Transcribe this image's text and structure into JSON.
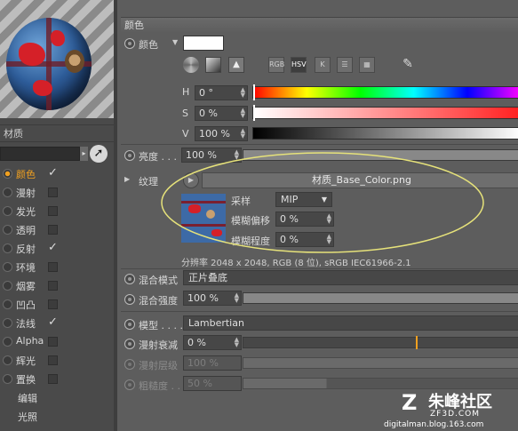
{
  "left": {
    "material_title": "材质",
    "channels": [
      {
        "label": "颜色",
        "checked": true,
        "active": true
      },
      {
        "label": "漫射",
        "checked": false
      },
      {
        "label": "发光",
        "checked": false
      },
      {
        "label": "透明",
        "checked": false
      },
      {
        "label": "反射",
        "checked": true
      },
      {
        "label": "环境",
        "checked": false
      },
      {
        "label": "烟雾",
        "checked": false
      },
      {
        "label": "凹凸",
        "checked": false
      },
      {
        "label": "法线",
        "checked": true
      },
      {
        "label": "Alpha",
        "checked": false
      },
      {
        "label": "辉光",
        "checked": false
      },
      {
        "label": "置换",
        "checked": false
      }
    ],
    "extra_items": [
      "编辑",
      "光照"
    ],
    "check_mark": "✓"
  },
  "color_section": {
    "header": "颜色",
    "color_label": "颜色",
    "swatch_color": "#ffffff",
    "modes": [
      "RGB",
      "HSV",
      "K"
    ],
    "selected_mode": "HSV",
    "h_label": "H",
    "h_value": "0 °",
    "s_label": "S",
    "s_value": "0 %",
    "v_label": "V",
    "v_value": "100 %"
  },
  "brightness": {
    "label": "亮度 . . .",
    "value": "100 %"
  },
  "texture": {
    "label": "纹理",
    "filename": "材质_Base_Color.png",
    "sampling_label": "采样",
    "sampling_value": "MIP",
    "blur_offset_label": "模糊偏移",
    "blur_offset_value": "0 %",
    "blur_scale_label": "模糊程度",
    "blur_scale_value": "0 %",
    "info": "分辨率 2048 x 2048, RGB (8 位), sRGB IEC61966-2.1"
  },
  "mix": {
    "mode_label": "混合模式",
    "mode_value": "正片叠底",
    "strength_label": "混合强度",
    "strength_value": "100 %"
  },
  "model": {
    "label": "模型 . . . .",
    "value": "Lambertian",
    "diffuse_falloff_label": "漫射衰减",
    "diffuse_falloff_value": "0 %",
    "diffuse_level_label": "漫射层级",
    "diffuse_level_value": "100 %",
    "roughness_label": "粗糙度 . .",
    "roughness_value": "50 %"
  },
  "watermark": {
    "brand": "朱峰社区",
    "site": "ZF3D.COM",
    "blog": "digitalman.blog.163.com"
  }
}
